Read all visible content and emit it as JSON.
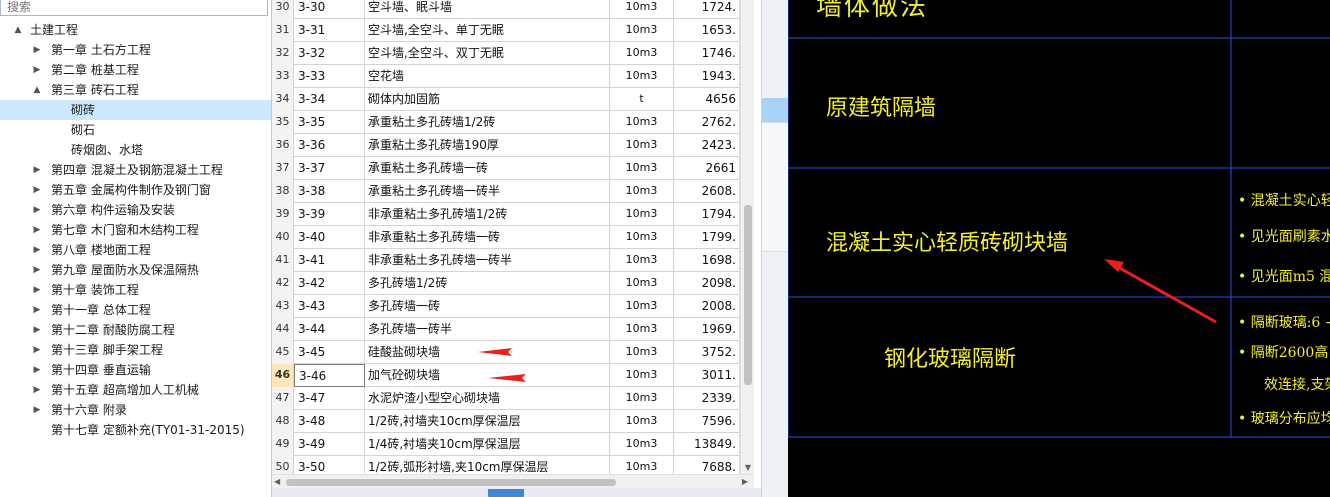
{
  "tree": {
    "search_placeholder": "搜索",
    "items": [
      {
        "label": "土建工程",
        "level": 0,
        "arrow": "▲"
      },
      {
        "label": "第一章 土石方工程",
        "level": 1,
        "arrow": "▶"
      },
      {
        "label": "第二章 桩基工程",
        "level": 1,
        "arrow": "▶"
      },
      {
        "label": "第三章 砖石工程",
        "level": 1,
        "arrow": "▲"
      },
      {
        "label": "砌砖",
        "level": 2,
        "arrow": "",
        "selected": true
      },
      {
        "label": "砌石",
        "level": 2,
        "arrow": ""
      },
      {
        "label": "砖烟囱、水塔",
        "level": 2,
        "arrow": ""
      },
      {
        "label": "第四章 混凝土及钢筋混凝土工程",
        "level": 1,
        "arrow": "▶"
      },
      {
        "label": "第五章 金属构件制作及钢门窗",
        "level": 1,
        "arrow": "▶"
      },
      {
        "label": "第六章 构件运输及安装",
        "level": 1,
        "arrow": "▶"
      },
      {
        "label": "第七章 木门窗和木结构工程",
        "level": 1,
        "arrow": "▶"
      },
      {
        "label": "第八章 楼地面工程",
        "level": 1,
        "arrow": "▶"
      },
      {
        "label": "第九章 屋面防水及保温隔热",
        "level": 1,
        "arrow": "▶"
      },
      {
        "label": "第十章 装饰工程",
        "level": 1,
        "arrow": "▶"
      },
      {
        "label": "第十一章 总体工程",
        "level": 1,
        "arrow": "▶"
      },
      {
        "label": "第十二章 耐酸防腐工程",
        "level": 1,
        "arrow": "▶"
      },
      {
        "label": "第十三章 脚手架工程",
        "level": 1,
        "arrow": "▶"
      },
      {
        "label": "第十四章 垂直运输",
        "level": 1,
        "arrow": "▶"
      },
      {
        "label": "第十五章 超高增加人工机械",
        "level": 1,
        "arrow": "▶"
      },
      {
        "label": "第十六章 附录",
        "level": 1,
        "arrow": "▶"
      },
      {
        "label": "第十七章 定额补充(TY01-31-2015)",
        "level": 1,
        "arrow": ""
      }
    ]
  },
  "table": {
    "current_row": "46",
    "rows": [
      {
        "idx": "30",
        "code": "3-30",
        "name": "空斗墙、眠斗墙",
        "unit": "10m3",
        "price": "1724."
      },
      {
        "idx": "31",
        "code": "3-31",
        "name": "空斗墙,全空斗、单丁无眠",
        "unit": "10m3",
        "price": "1653."
      },
      {
        "idx": "32",
        "code": "3-32",
        "name": "空斗墙,全空斗、双丁无眠",
        "unit": "10m3",
        "price": "1746."
      },
      {
        "idx": "33",
        "code": "3-33",
        "name": "空花墙",
        "unit": "10m3",
        "price": "1943."
      },
      {
        "idx": "34",
        "code": "3-34",
        "name": "砌体内加固筋",
        "unit": "t",
        "price": "4656"
      },
      {
        "idx": "35",
        "code": "3-35",
        "name": "承重粘土多孔砖墙1/2砖",
        "unit": "10m3",
        "price": "2762."
      },
      {
        "idx": "36",
        "code": "3-36",
        "name": "承重粘土多孔砖墙190厚",
        "unit": "10m3",
        "price": "2423."
      },
      {
        "idx": "37",
        "code": "3-37",
        "name": "承重粘土多孔砖墙一砖",
        "unit": "10m3",
        "price": "2661"
      },
      {
        "idx": "38",
        "code": "3-38",
        "name": "承重粘土多孔砖墙一砖半",
        "unit": "10m3",
        "price": "2608."
      },
      {
        "idx": "39",
        "code": "3-39",
        "name": "非承重粘土多孔砖墙1/2砖",
        "unit": "10m3",
        "price": "1794."
      },
      {
        "idx": "40",
        "code": "3-40",
        "name": "非承重粘土多孔砖墙一砖",
        "unit": "10m3",
        "price": "1799."
      },
      {
        "idx": "41",
        "code": "3-41",
        "name": "非承重粘土多孔砖墙一砖半",
        "unit": "10m3",
        "price": "1698."
      },
      {
        "idx": "42",
        "code": "3-42",
        "name": "多孔砖墙1/2砖",
        "unit": "10m3",
        "price": "2098."
      },
      {
        "idx": "43",
        "code": "3-43",
        "name": "多孔砖墙一砖",
        "unit": "10m3",
        "price": "2008."
      },
      {
        "idx": "44",
        "code": "3-44",
        "name": "多孔砖墙一砖半",
        "unit": "10m3",
        "price": "1969."
      },
      {
        "idx": "45",
        "code": "3-45",
        "name": "硅酸盐砌块墙",
        "unit": "10m3",
        "price": "3752."
      },
      {
        "idx": "46",
        "code": "3-46",
        "name": "加气砼砌块墙",
        "unit": "10m3",
        "price": "3011."
      },
      {
        "idx": "47",
        "code": "3-47",
        "name": "水泥炉渣小型空心砌块墙",
        "unit": "10m3",
        "price": "2339."
      },
      {
        "idx": "48",
        "code": "3-48",
        "name": "1/2砖,衬墙夹10cm厚保温层",
        "unit": "10m3",
        "price": "7596."
      },
      {
        "idx": "49",
        "code": "3-49",
        "name": "1/4砖,衬墙夹10cm厚保温层",
        "unit": "10m3",
        "price": "13849."
      },
      {
        "idx": "50",
        "code": "3-50",
        "name": "1/2砖,弧形衬墙,夹10cm厚保温层",
        "unit": "10m3",
        "price": "7688."
      }
    ]
  },
  "cad": {
    "title": "墙体做法",
    "cell_1": "原建筑隔墙",
    "cell_2": "混凝土实心轻质砖砌块墙",
    "cell_3": "钢化玻璃隔断",
    "note_1": "• 混凝土实心轻",
    "note_2": "• 见光面刷素水",
    "note_3": "• 见光面m5 混",
    "note_4": "• 隔断玻璃:6 +",
    "note_5": "• 隔断2600高",
    "note_6": "效连接,支架",
    "note_7": "• 玻璃分布应均",
    "line_color": "#2d4fe8",
    "text_color": "#f3ee2e",
    "arrow_color": "#e8211f"
  }
}
